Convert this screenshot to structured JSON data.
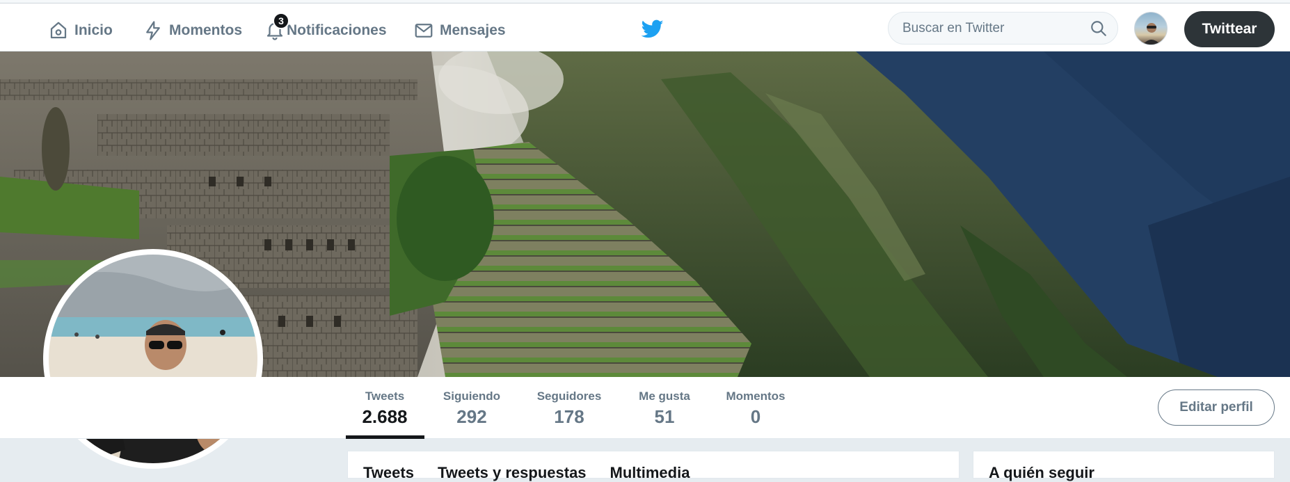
{
  "nav": {
    "home_label": "Inicio",
    "moments_label": "Momentos",
    "notifications_label": "Notificaciones",
    "notifications_count": "3",
    "messages_label": "Mensajes",
    "search_placeholder": "Buscar en Twitter",
    "tweet_button": "Twittear"
  },
  "profile": {
    "stats": [
      {
        "label": "Tweets",
        "value": "2.688"
      },
      {
        "label": "Siguiendo",
        "value": "292"
      },
      {
        "label": "Seguidores",
        "value": "178"
      },
      {
        "label": "Me gusta",
        "value": "51"
      },
      {
        "label": "Momentos",
        "value": "0"
      }
    ],
    "active_tab": "Tweets",
    "edit_button": "Editar perfil"
  },
  "timeline": {
    "tabs": [
      "Tweets",
      "Tweets y respuestas",
      "Multimedia"
    ]
  },
  "sidebar": {
    "card_title": "A quién seguir"
  },
  "colors": {
    "brand": "#1da1f2",
    "dark_button": "#2d3438",
    "muted_text": "#657786",
    "background": "#e6ecf0"
  }
}
